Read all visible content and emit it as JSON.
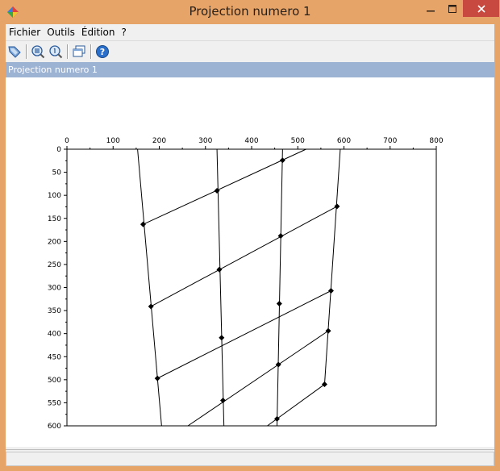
{
  "window": {
    "title": "Projection numero 1"
  },
  "menu": [
    "Fichier",
    "Outils",
    "Édition",
    "?"
  ],
  "toolbar": {
    "buttons": [
      "select-arrow-icon",
      "zoom-grid-icon",
      "zoom-1-icon",
      "windows-icon",
      "help-icon"
    ]
  },
  "panel": {
    "title": "Projection numero 1"
  },
  "status": {
    "text": ""
  },
  "chart_data": {
    "type": "line",
    "title": "",
    "xlabel": "",
    "ylabel": "",
    "xlim": [
      0,
      800
    ],
    "ylim": [
      600,
      0
    ],
    "x_ticks": [
      0,
      100,
      200,
      300,
      400,
      500,
      600,
      700,
      800
    ],
    "y_ticks": [
      0,
      50,
      100,
      150,
      200,
      250,
      300,
      350,
      400,
      450,
      500,
      550,
      600
    ],
    "x_axis_position": "top",
    "grid": false,
    "vertical_lines": [
      [
        [
          153,
          0
        ],
        [
          205,
          600
        ]
      ],
      [
        [
          325,
          0
        ],
        [
          340,
          600
        ]
      ],
      [
        [
          467,
          0
        ],
        [
          455,
          600
        ]
      ],
      [
        [
          592,
          0
        ],
        [
          558,
          510
        ]
      ]
    ],
    "diagonal_lines": [
      [
        [
          165,
          163
        ],
        [
          518,
          0
        ]
      ],
      [
        [
          182,
          341
        ],
        [
          585,
          124
        ]
      ],
      [
        [
          196,
          497
        ],
        [
          572,
          307
        ]
      ],
      [
        [
          262,
          600
        ],
        [
          566,
          394
        ]
      ],
      [
        [
          434,
          600
        ],
        [
          558,
          510
        ]
      ]
    ],
    "markers": [
      [
        467,
        24
      ],
      [
        325,
        90
      ],
      [
        165,
        163
      ],
      [
        585,
        124
      ],
      [
        463,
        188
      ],
      [
        330,
        261
      ],
      [
        182,
        341
      ],
      [
        572,
        307
      ],
      [
        460,
        335
      ],
      [
        335,
        409
      ],
      [
        196,
        497
      ],
      [
        566,
        394
      ],
      [
        458,
        467
      ],
      [
        338,
        545
      ],
      [
        558,
        510
      ],
      [
        455,
        585
      ]
    ]
  }
}
